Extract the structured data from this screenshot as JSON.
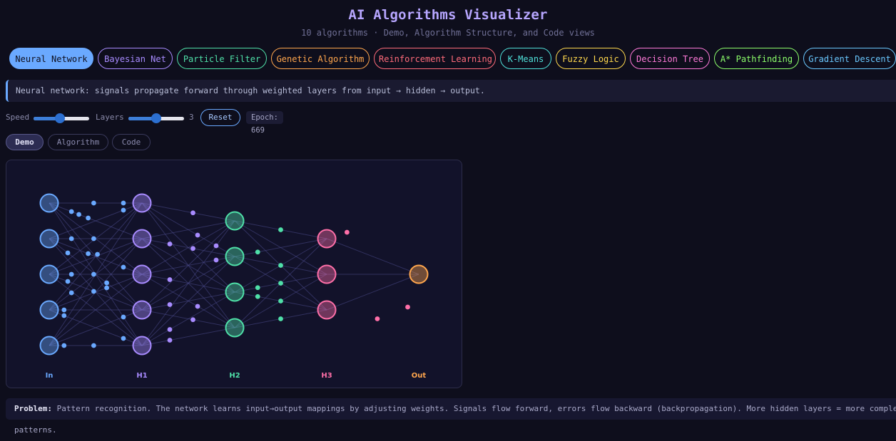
{
  "header": {
    "title": "AI Algorithms Visualizer",
    "subtitle": "10 algorithms · Demo, Algorithm Structure, and Code views"
  },
  "algorithms": [
    {
      "label": "Neural Network",
      "color": "#6aa9ff",
      "active": true
    },
    {
      "label": "Bayesian Net",
      "color": "#a88bff",
      "active": false
    },
    {
      "label": "Particle Filter",
      "color": "#4fe0a8",
      "active": false
    },
    {
      "label": "Genetic Algorithm",
      "color": "#ffa64d",
      "active": false
    },
    {
      "label": "Reinforcement Learning",
      "color": "#ff6b7a",
      "active": false
    },
    {
      "label": "K-Means",
      "color": "#4fe0d9",
      "active": false
    },
    {
      "label": "Fuzzy Logic",
      "color": "#ffd84d",
      "active": false
    },
    {
      "label": "Decision Tree",
      "color": "#ff7ad9",
      "active": false
    },
    {
      "label": "A* Pathfinding",
      "color": "#8cff6b",
      "active": false
    },
    {
      "label": "Gradient Descent",
      "color": "#6ac8ff",
      "active": false
    }
  ],
  "info": {
    "text": "Neural network: signals propagate forward through weighted layers from input → hidden → output.",
    "accent": "#6aa9ff"
  },
  "controls": {
    "speed_label": "Speed",
    "speed_level": 0.48,
    "layers_label": "Layers",
    "layers_level": 0.5,
    "layers_value": "3",
    "reset_label": "Reset",
    "epoch_text": "Epoch: 669"
  },
  "views": [
    {
      "label": "Demo",
      "active": true
    },
    {
      "label": "Algorithm",
      "active": false
    },
    {
      "label": "Code",
      "active": false
    }
  ],
  "network": {
    "layers": [
      {
        "label": "In",
        "nodes": 5,
        "color": "#6aa9ff"
      },
      {
        "label": "H1",
        "nodes": 5,
        "color": "#a88bff"
      },
      {
        "label": "H2",
        "nodes": 4,
        "color": "#4fe0a8"
      },
      {
        "label": "H3",
        "nodes": 3,
        "color": "#ff6fa8"
      },
      {
        "label": "Out",
        "nodes": 1,
        "color": "#ffa64d"
      }
    ]
  },
  "problem": {
    "label": "Problem:",
    "text": "Pattern recognition. The network learns input→output mappings by adjusting weights. Signals flow forward, errors flow backward (backpropagation). More hidden layers = more complex patterns."
  }
}
